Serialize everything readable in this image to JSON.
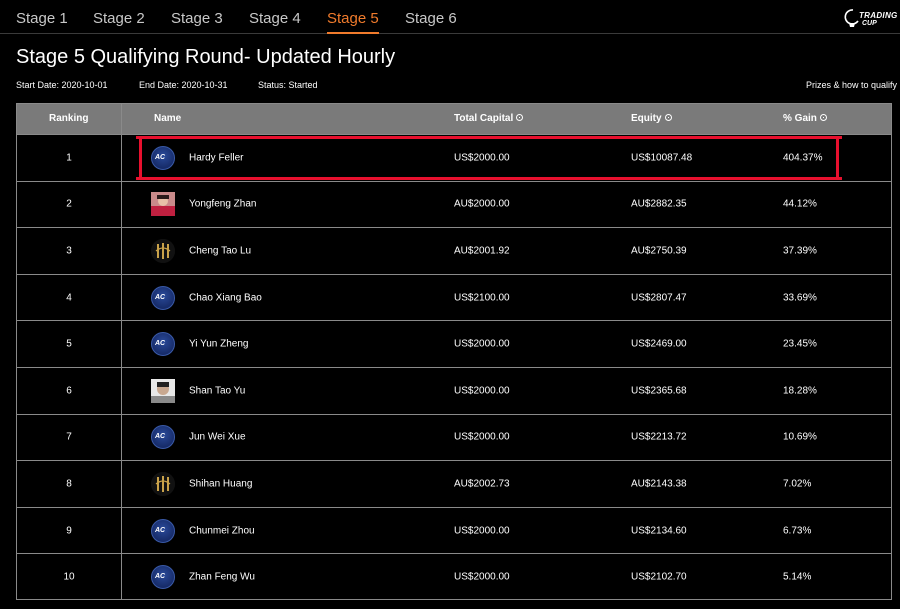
{
  "tabs": [
    {
      "label": "Stage 1",
      "active": false
    },
    {
      "label": "Stage 2",
      "active": false
    },
    {
      "label": "Stage 3",
      "active": false
    },
    {
      "label": "Stage 4",
      "active": false
    },
    {
      "label": "Stage 5",
      "active": true
    },
    {
      "label": "Stage 6",
      "active": false
    }
  ],
  "logo": {
    "line1": "TRADING",
    "line2": "CUP"
  },
  "page_title": "Stage 5 Qualifying Round- Updated Hourly",
  "meta": {
    "start_date": "Start Date: 2020-10-01",
    "end_date": "End Date: 2020-10-31",
    "status": "Status: Started"
  },
  "prizes_link": "Prizes & how to qualify",
  "columns": {
    "ranking": "Ranking",
    "name": "Name",
    "total_capital": "Total Capital",
    "equity": "Equity",
    "gain": "% Gain"
  },
  "rows": [
    {
      "rank": "1",
      "avatar": "ac-logo",
      "name": "Hardy Feller",
      "capital": "US$2000.00",
      "equity": "US$10087.48",
      "gain": "404.37%"
    },
    {
      "rank": "2",
      "avatar": "photo",
      "name": "Yongfeng Zhan",
      "capital": "AU$2000.00",
      "equity": "AU$2882.35",
      "gain": "44.12%"
    },
    {
      "rank": "3",
      "avatar": "gold-emblem",
      "name": "Cheng Tao Lu",
      "capital": "AU$2001.92",
      "equity": "AU$2750.39",
      "gain": "37.39%"
    },
    {
      "rank": "4",
      "avatar": "ac-logo",
      "name": "Chao Xiang Bao",
      "capital": "US$2100.00",
      "equity": "US$2807.47",
      "gain": "33.69%"
    },
    {
      "rank": "5",
      "avatar": "ac-logo",
      "name": "Yi Yun Zheng",
      "capital": "US$2000.00",
      "equity": "US$2469.00",
      "gain": "23.45%"
    },
    {
      "rank": "6",
      "avatar": "photo",
      "name": "Shan Tao Yu",
      "capital": "US$2000.00",
      "equity": "US$2365.68",
      "gain": "18.28%"
    },
    {
      "rank": "7",
      "avatar": "ac-logo",
      "name": "Jun Wei Xue",
      "capital": "US$2000.00",
      "equity": "US$2213.72",
      "gain": "10.69%"
    },
    {
      "rank": "8",
      "avatar": "gold-emblem",
      "name": "Shihan Huang",
      "capital": "AU$2002.73",
      "equity": "AU$2143.38",
      "gain": "7.02%"
    },
    {
      "rank": "9",
      "avatar": "ac-logo",
      "name": "Chunmei Zhou",
      "capital": "US$2000.00",
      "equity": "US$2134.60",
      "gain": "6.73%"
    },
    {
      "rank": "10",
      "avatar": "ac-logo",
      "name": "Zhan Feng Wu",
      "capital": "US$2000.00",
      "equity": "US$2102.70",
      "gain": "5.14%"
    }
  ],
  "avatar_text": "AC",
  "colors": {
    "accent": "#f07b2c",
    "highlight": "#e8102e",
    "header_bg": "#7a7a7a",
    "background": "#000000"
  }
}
